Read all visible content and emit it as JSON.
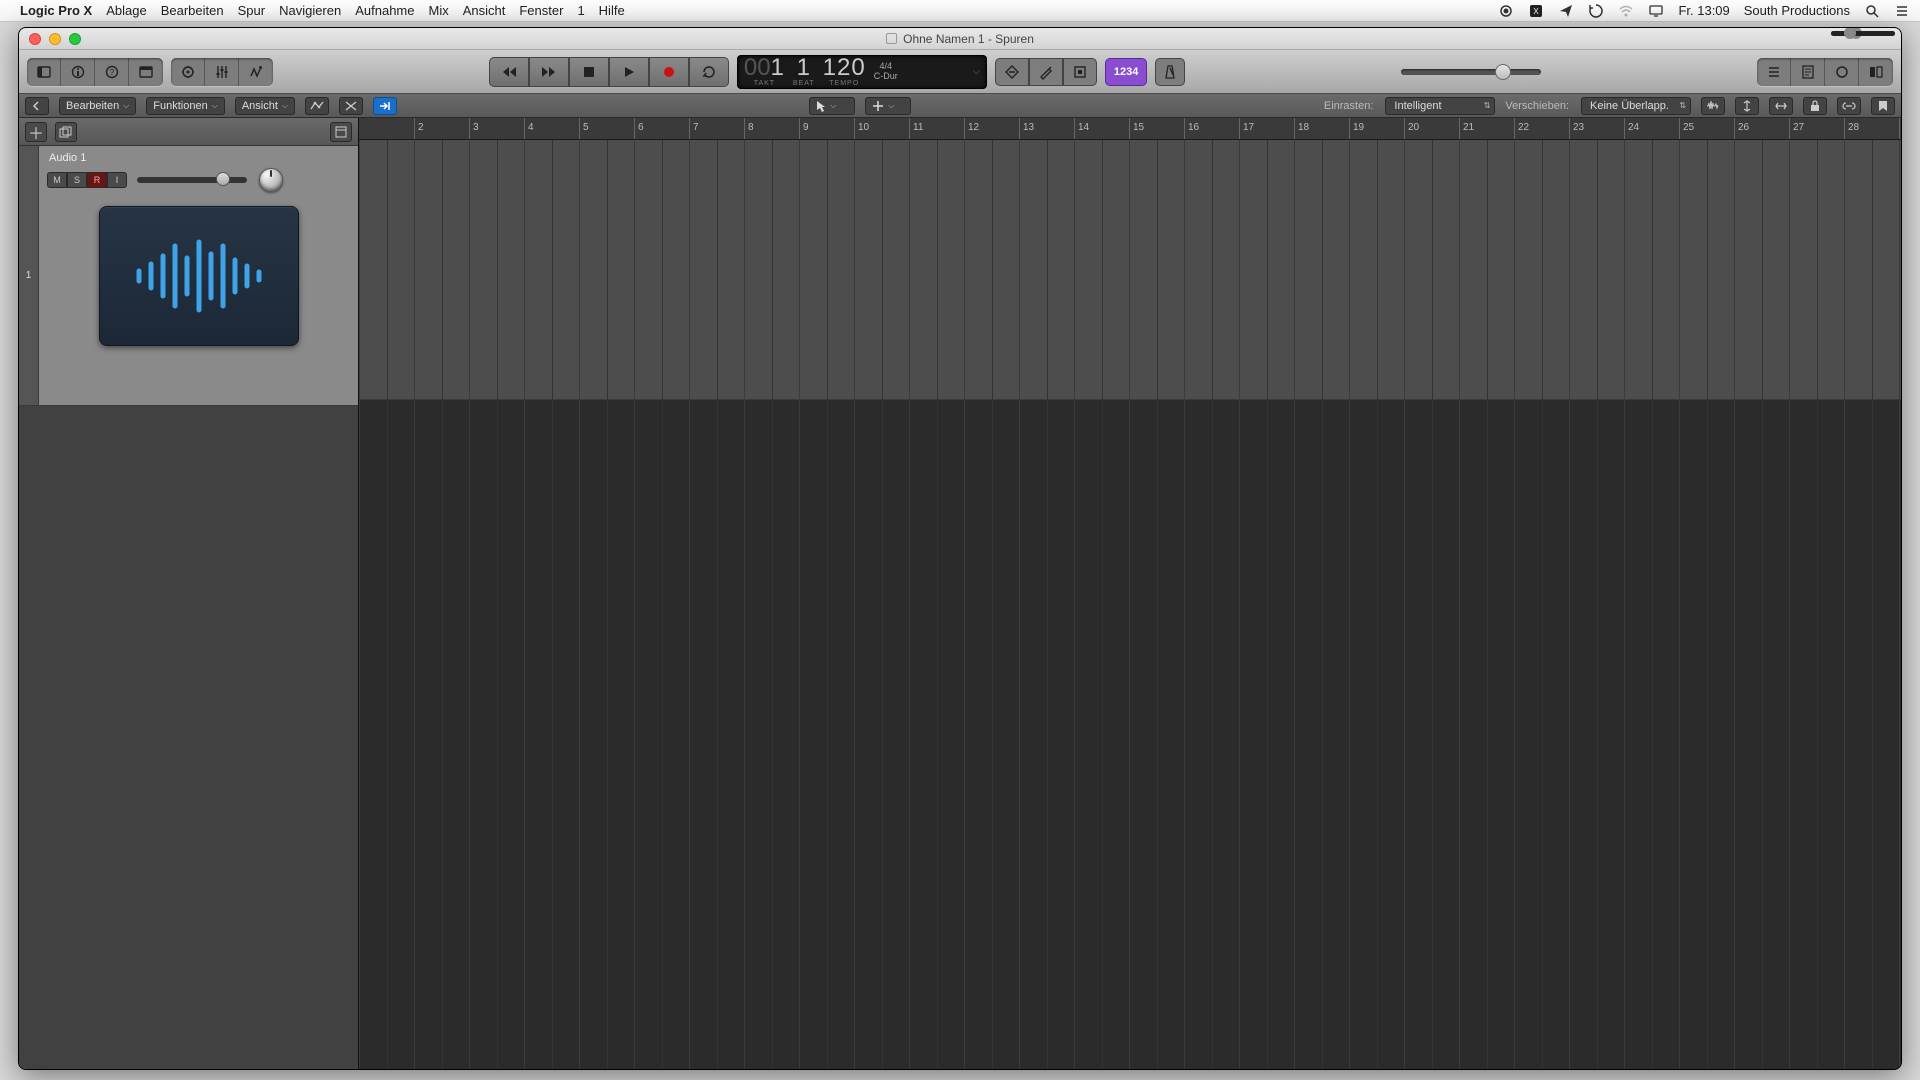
{
  "menubar": {
    "app": "Logic Pro X",
    "items": [
      "Ablage",
      "Bearbeiten",
      "Spur",
      "Navigieren",
      "Aufnahme",
      "Mix",
      "Ansicht",
      "Fenster",
      "1",
      "Hilfe"
    ],
    "clock": "Fr. 13:09",
    "user": "South Productions"
  },
  "window": {
    "title": "Ohne Namen 1 - Spuren"
  },
  "lcd": {
    "takt_dim": "00",
    "takt": "1",
    "beat": "1",
    "tempo": "120",
    "sig": "4/4",
    "key": "C-Dur",
    "labels": {
      "takt": "TAKT",
      "beat": "BEAT",
      "tempo": "TEMPO"
    }
  },
  "countin": "1234",
  "trackheader": {
    "menus": [
      "Bearbeiten",
      "Funktionen",
      "Ansicht"
    ],
    "snap_label": "Einrasten:",
    "snap_value": "Intelligent",
    "move_label": "Verschieben:",
    "move_value": "Keine Überlapp."
  },
  "track": {
    "index": "1",
    "name": "Audio 1",
    "buttons": {
      "m": "M",
      "s": "S",
      "r": "R",
      "i": "I"
    }
  },
  "ruler": {
    "start": 2,
    "end": 29,
    "barWidth": 55
  },
  "volume": {
    "percent": 67
  },
  "fader": {
    "percent": 72
  },
  "hzoom": {
    "percent": 20
  }
}
